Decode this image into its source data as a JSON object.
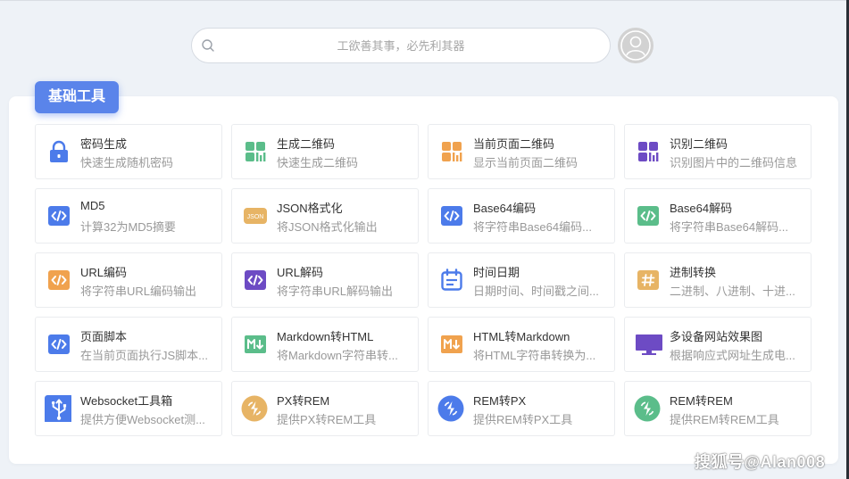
{
  "search": {
    "placeholder": "工欲善其事，必先利其器"
  },
  "section": {
    "title": "基础工具"
  },
  "colors": {
    "accent": "#5a84ea",
    "green": "#5bbd8a",
    "orange": "#f0a24e",
    "purple": "#6d4bc4",
    "gold": "#e7b465"
  },
  "tools": [
    {
      "title": "密码生成",
      "desc": "快速生成随机密码",
      "icon": "lock-icon"
    },
    {
      "title": "生成二维码",
      "desc": "快速生成二维码",
      "icon": "qrcode-green-icon"
    },
    {
      "title": "当前页面二维码",
      "desc": "显示当前页面二维码",
      "icon": "qrcode-orange-icon"
    },
    {
      "title": "识别二维码",
      "desc": "识别图片中的二维码信息",
      "icon": "qrcode-purple-icon"
    },
    {
      "title": "MD5",
      "desc": "计算32为MD5摘要",
      "icon": "code-blue-icon"
    },
    {
      "title": "JSON格式化",
      "desc": "将JSON格式化输出",
      "icon": "json-icon"
    },
    {
      "title": "Base64编码",
      "desc": "将字符串Base64编码...",
      "icon": "code-blue-icon"
    },
    {
      "title": "Base64解码",
      "desc": "将字符串Base64解码...",
      "icon": "code-green-icon"
    },
    {
      "title": "URL编码",
      "desc": "将字符串URL编码输出",
      "icon": "code-orange-icon"
    },
    {
      "title": "URL解码",
      "desc": "将字符串URL解码输出",
      "icon": "code-purple-icon"
    },
    {
      "title": "时间日期",
      "desc": "日期时间、时间戳之间...",
      "icon": "calendar-icon"
    },
    {
      "title": "进制转换",
      "desc": "二进制、八进制、十进...",
      "icon": "hash-icon"
    },
    {
      "title": "页面脚本",
      "desc": "在当前页面执行JS脚本...",
      "icon": "code-blue-icon"
    },
    {
      "title": "Markdown转HTML",
      "desc": "将Markdown字符串转...",
      "icon": "markdown-green-icon"
    },
    {
      "title": "HTML转Markdown",
      "desc": "将HTML字符串转换为...",
      "icon": "markdown-orange-icon"
    },
    {
      "title": "多设备网站效果图",
      "desc": "根据响应式网址生成电...",
      "icon": "monitor-icon"
    },
    {
      "title": "Websocket工具箱",
      "desc": "提供方便Websocket测...",
      "icon": "usb-icon"
    },
    {
      "title": "PX转REM",
      "desc": "提供PX转REM工具",
      "icon": "convert-gold-icon"
    },
    {
      "title": "REM转PX",
      "desc": "提供REM转PX工具",
      "icon": "convert-blue-icon"
    },
    {
      "title": "REM转REM",
      "desc": "提供REM转REM工具",
      "icon": "convert-green-icon"
    }
  ],
  "watermark": "搜狐号@Alan008"
}
